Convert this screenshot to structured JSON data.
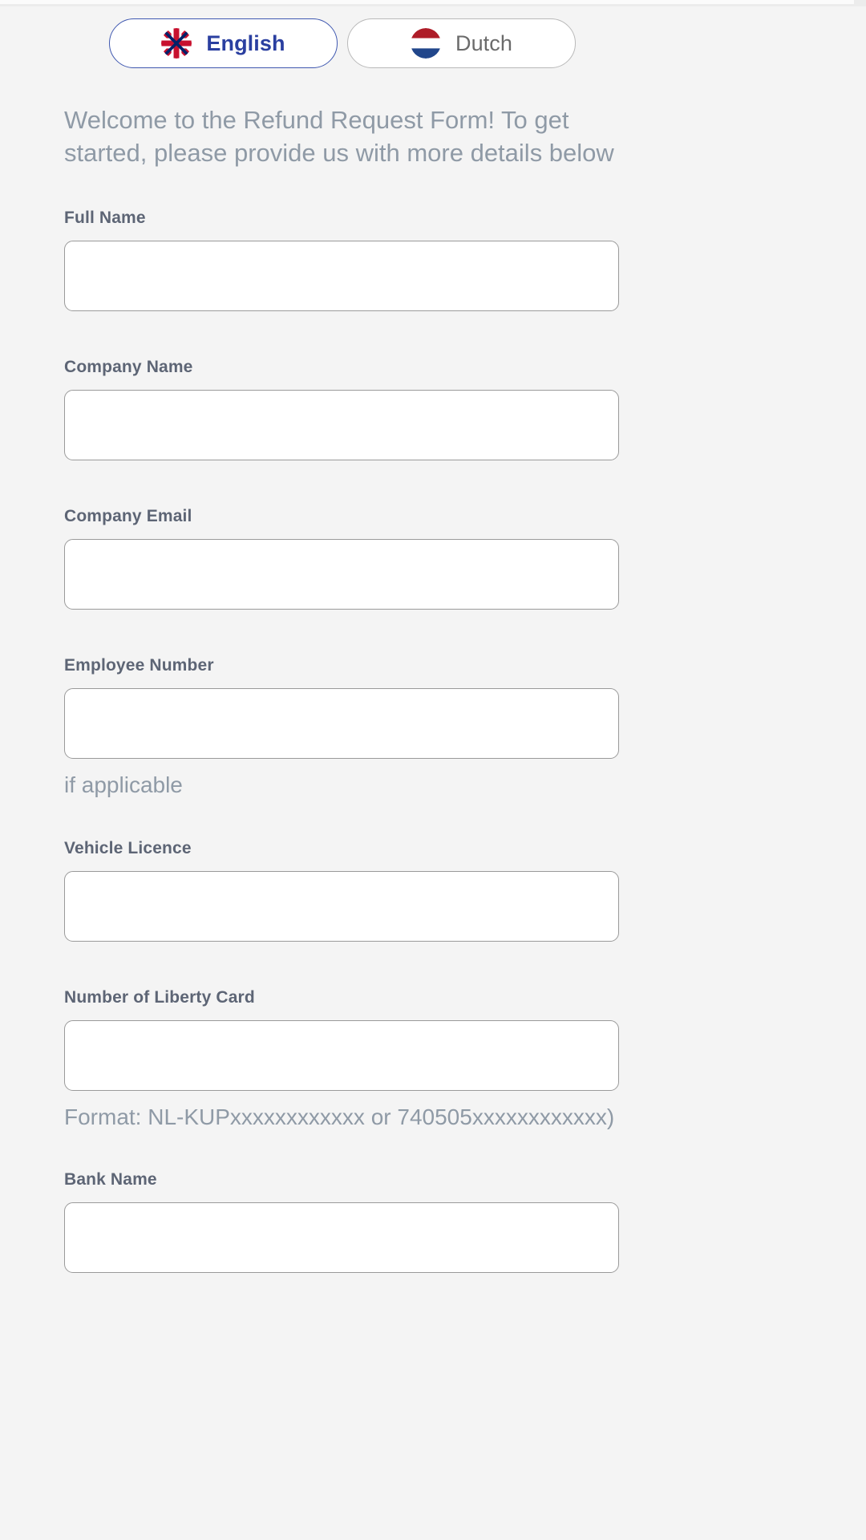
{
  "language_switch": {
    "options": [
      {
        "label": "English",
        "flag": "uk-flag-icon",
        "selected": true
      },
      {
        "label": "Dutch",
        "flag": "netherlands-flag-icon",
        "selected": false
      }
    ],
    "selected_color": "#2a3fa0",
    "unselected_color": "#6b6b6b"
  },
  "intro": {
    "text": "Welcome to the Refund Request Form! To get started, please provide us with more details below"
  },
  "form": {
    "fields": [
      {
        "label": "Full Name",
        "value": "",
        "placeholder": "",
        "help": ""
      },
      {
        "label": "Company Name",
        "value": "",
        "placeholder": "",
        "help": ""
      },
      {
        "label": "Company Email",
        "value": "",
        "placeholder": "",
        "help": ""
      },
      {
        "label": "Employee Number",
        "value": "",
        "placeholder": "",
        "help": "if applicable"
      },
      {
        "label": "Vehicle Licence",
        "value": "",
        "placeholder": "",
        "help": ""
      },
      {
        "label": "Number of Liberty Card",
        "value": "",
        "placeholder": "",
        "help": "Format: NL-KUPxxxxxxxxxxxx or 740505xxxxxxxxxxxx)"
      },
      {
        "label": "Bank Name",
        "value": "",
        "placeholder": "",
        "help": ""
      }
    ]
  },
  "theme": {
    "background": "#f4f4f4",
    "input_background": "#ffffff",
    "input_border": "#9a9a9a",
    "label_color": "#5d6575",
    "help_color": "#8f9aa6"
  }
}
